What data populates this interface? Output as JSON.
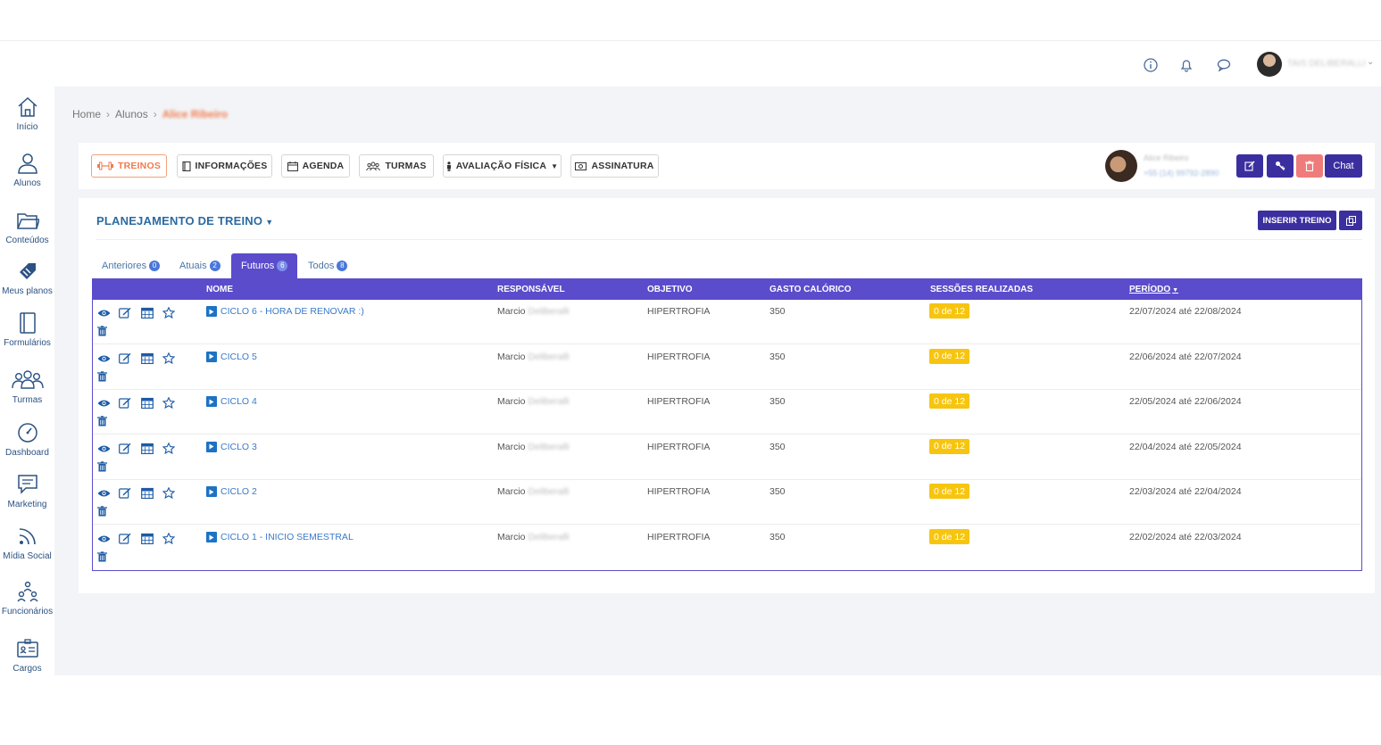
{
  "topbar": {
    "icons": [
      "info-icon",
      "bell-icon",
      "chat-bubble-icon"
    ],
    "user_name": "TAIS DELIBERALLI"
  },
  "sidebar": {
    "items": [
      {
        "label": "Início",
        "icon": "home-icon"
      },
      {
        "label": "Alunos",
        "icon": "user-icon"
      },
      {
        "label": "Conteúdos",
        "icon": "folder-icon"
      },
      {
        "label": "Meus planos",
        "icon": "tag-icon"
      },
      {
        "label": "Formulários",
        "icon": "notebook-icon"
      },
      {
        "label": "Turmas",
        "icon": "group-icon"
      },
      {
        "label": "Dashboard",
        "icon": "gauge-icon"
      },
      {
        "label": "Marketing",
        "icon": "message-icon"
      },
      {
        "label": "Mídia Social",
        "icon": "rss-icon"
      },
      {
        "label": "Funcionários",
        "icon": "org-chart-icon"
      },
      {
        "label": "Cargos",
        "icon": "badge-icon"
      }
    ]
  },
  "breadcrumb": {
    "home": "Home",
    "alunos": "Alunos",
    "current": "Alice Ribeiro"
  },
  "student_tabs": [
    {
      "label": "TREINOS",
      "icon": "dumbbell-icon",
      "active": true
    },
    {
      "label": "INFORMAÇÕES",
      "icon": "book-icon",
      "active": false
    },
    {
      "label": "AGENDA",
      "icon": "calendar-icon",
      "active": false
    },
    {
      "label": "TURMAS",
      "icon": "group-icon",
      "active": false
    },
    {
      "label": "AVALIAÇÃO FÍSICA",
      "icon": "person-icon",
      "active": false
    },
    {
      "label": "ASSINATURA",
      "icon": "money-icon",
      "active": false
    }
  ],
  "profile": {
    "name": "Alice Ribeiro",
    "phone": "+55 (14) 99792-2890",
    "chat_label": "Chat"
  },
  "planning": {
    "title": "PLANEJAMENTO DE TREINO",
    "insert_label": "INSERIR TREINO"
  },
  "filter_tabs": [
    {
      "label": "Anteriores",
      "count": "0",
      "active": false
    },
    {
      "label": "Atuais",
      "count": "2",
      "active": false
    },
    {
      "label": "Futuros",
      "count": "6",
      "active": true
    },
    {
      "label": "Todos",
      "count": "8",
      "active": false
    }
  ],
  "table": {
    "headers": {
      "nome": "NOME",
      "responsavel": "RESPONSÁVEL",
      "objetivo": "OBJETIVO",
      "gasto": "GASTO CALÓRICO",
      "sessoes": "SESSÕES REALIZADAS",
      "periodo": "PERÍODO"
    },
    "rows": [
      {
        "nome": "CICLO 6 - HORA DE RENOVAR :)",
        "resp_first": "Marcio",
        "resp_last": "Deliberalli",
        "objetivo": "HIPERTROFIA",
        "gasto": "350",
        "sessoes": "0 de 12",
        "periodo": "22/07/2024 até 22/08/2024"
      },
      {
        "nome": "CICLO 5",
        "resp_first": "Marcio",
        "resp_last": "Deliberalli",
        "objetivo": "HIPERTROFIA",
        "gasto": "350",
        "sessoes": "0 de 12",
        "periodo": "22/06/2024 até 22/07/2024"
      },
      {
        "nome": "CICLO 4",
        "resp_first": "Marcio",
        "resp_last": "Deliberalli",
        "objetivo": "HIPERTROFIA",
        "gasto": "350",
        "sessoes": "0 de 12",
        "periodo": "22/05/2024 até 22/06/2024"
      },
      {
        "nome": "CICLO 3",
        "resp_first": "Marcio",
        "resp_last": "Deliberalli",
        "objetivo": "HIPERTROFIA",
        "gasto": "350",
        "sessoes": "0 de 12",
        "periodo": "22/04/2024 até 22/05/2024"
      },
      {
        "nome": "CICLO 2",
        "resp_first": "Marcio",
        "resp_last": "Deliberalli",
        "objetivo": "HIPERTROFIA",
        "gasto": "350",
        "sessoes": "0 de 12",
        "periodo": "22/03/2024 até 22/04/2024"
      },
      {
        "nome": "CICLO 1 - INICIO SEMESTRAL",
        "resp_first": "Marcio",
        "resp_last": "Deliberalli",
        "objetivo": "HIPERTROFIA",
        "gasto": "350",
        "sessoes": "0 de 12",
        "periodo": "22/02/2024 até 22/03/2024"
      }
    ]
  },
  "colors": {
    "primary": "#3b2fa0",
    "table_header": "#5b4ccc",
    "accent_orange": "#f07b4f",
    "badge_yellow": "#f7c510",
    "danger": "#f07b7b",
    "link_blue": "#3a7ac8"
  }
}
